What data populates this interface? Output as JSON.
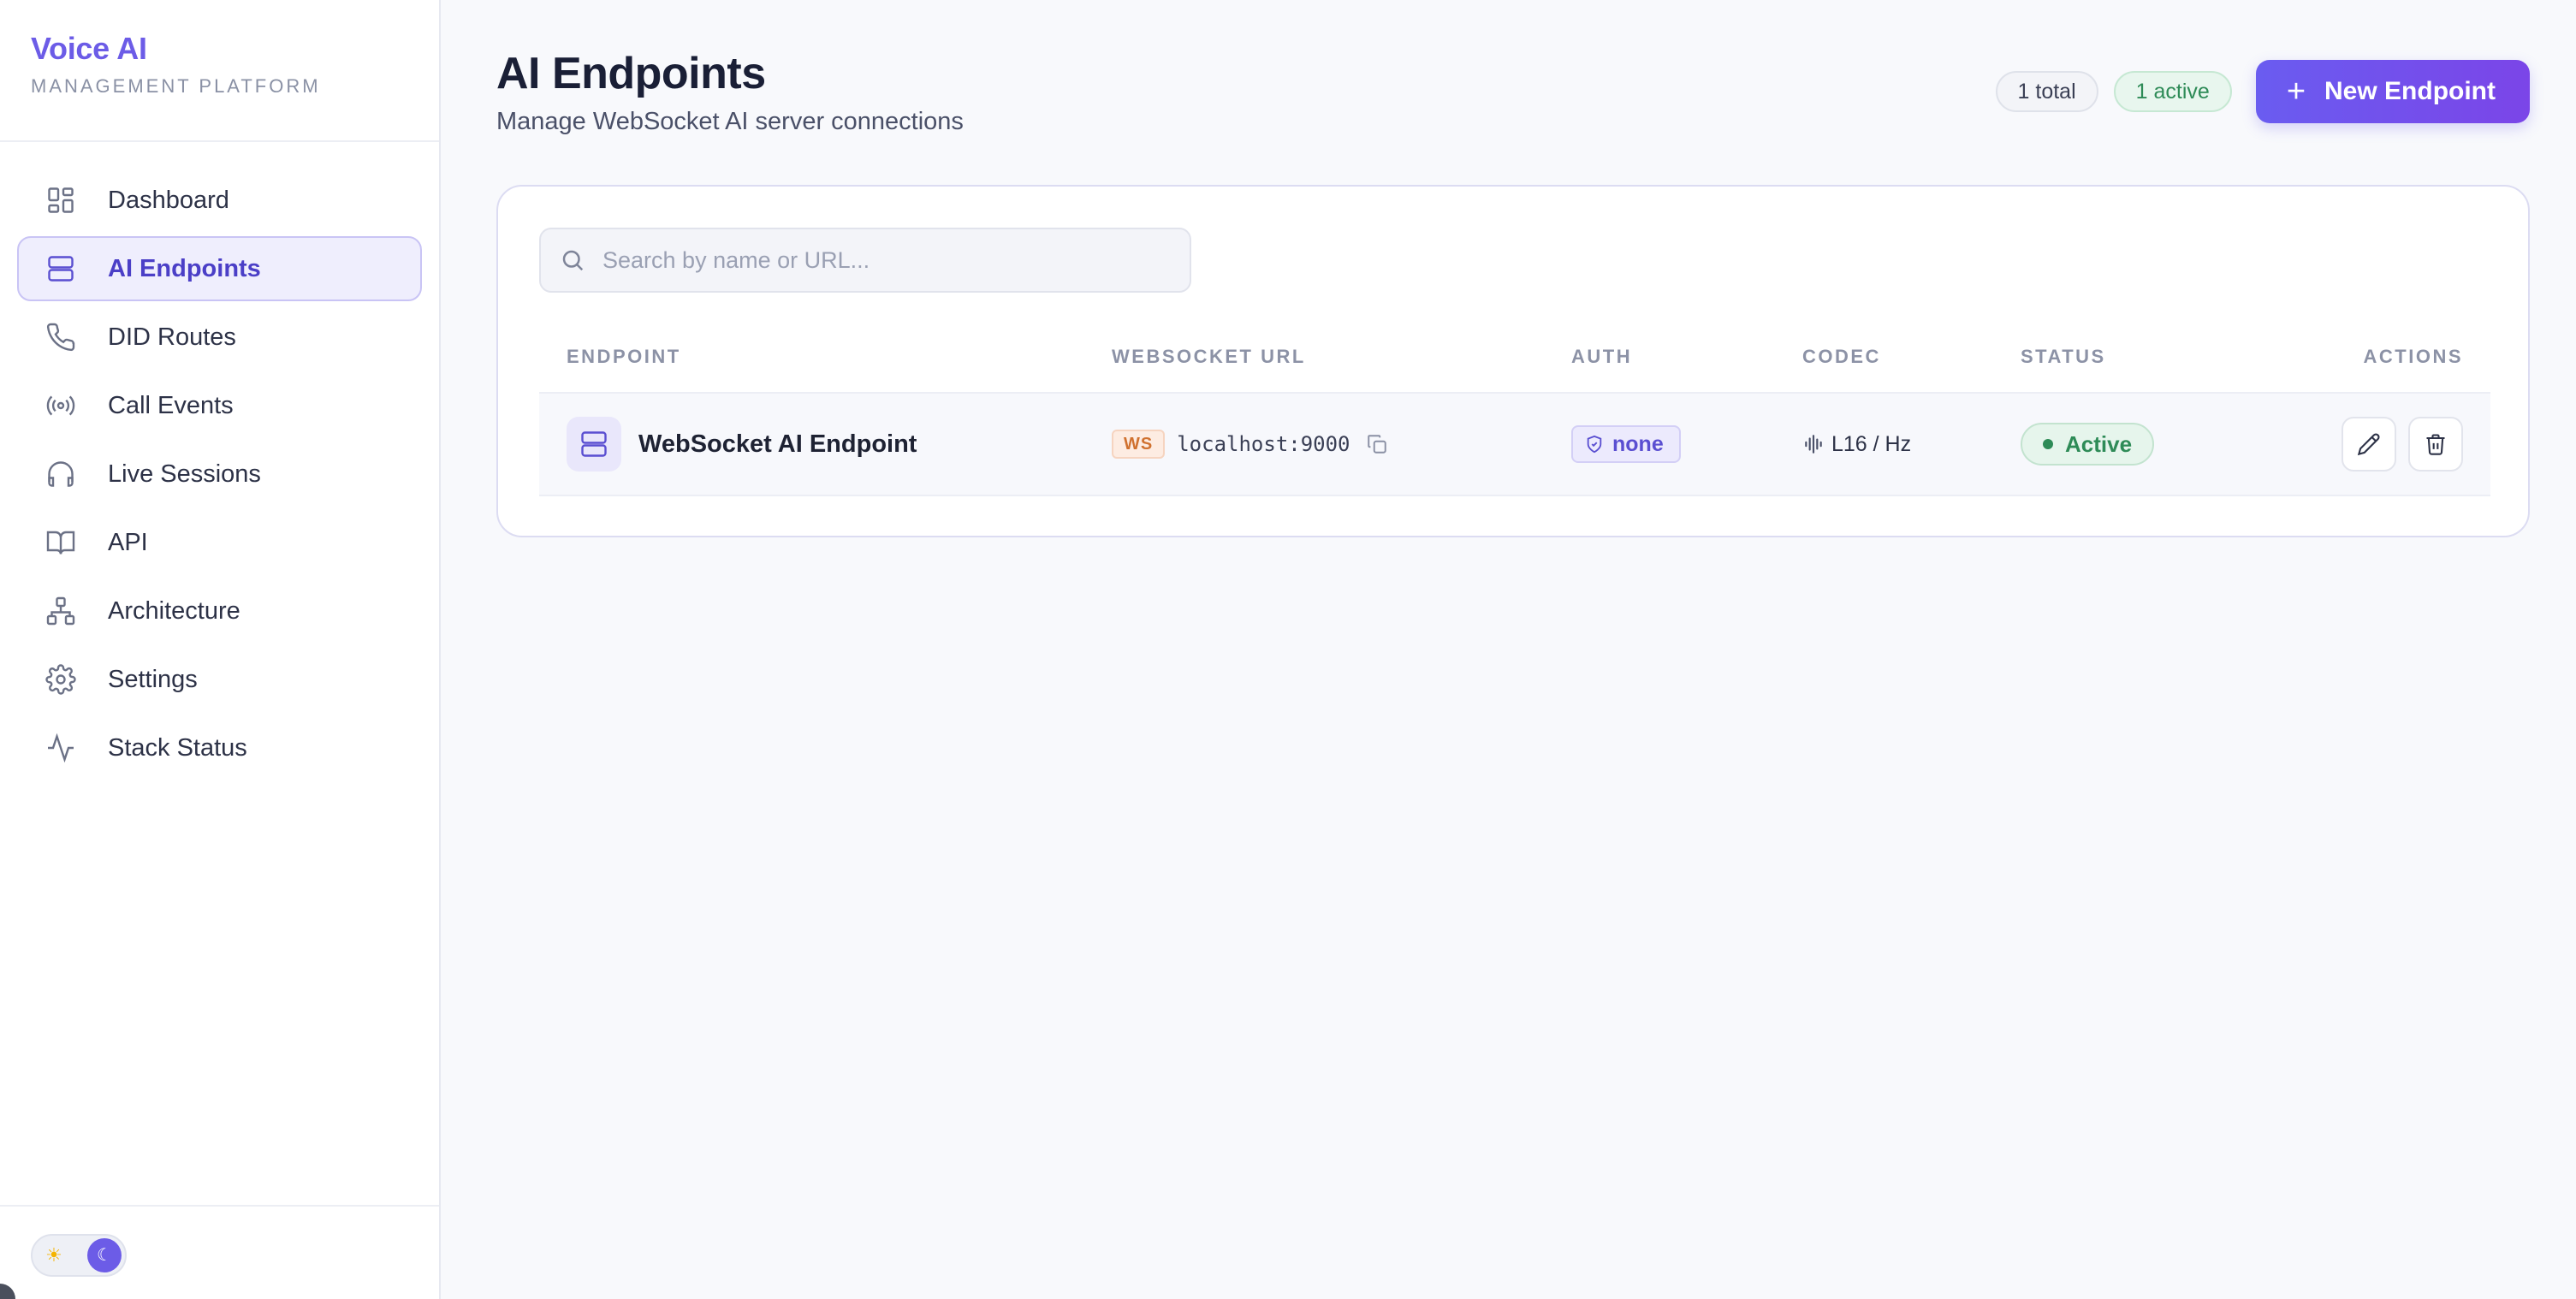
{
  "brand": {
    "title": "Voice AI",
    "subtitle": "MANAGEMENT PLATFORM"
  },
  "sidebar": {
    "items": [
      {
        "label": "Dashboard",
        "icon": "dashboard-icon",
        "active": false
      },
      {
        "label": "AI Endpoints",
        "icon": "server-icon",
        "active": true
      },
      {
        "label": "DID Routes",
        "icon": "phone-icon",
        "active": false
      },
      {
        "label": "Call Events",
        "icon": "broadcast-icon",
        "active": false
      },
      {
        "label": "Live Sessions",
        "icon": "headphones-icon",
        "active": false
      },
      {
        "label": "API",
        "icon": "book-icon",
        "active": false
      },
      {
        "label": "Architecture",
        "icon": "network-icon",
        "active": false
      },
      {
        "label": "Settings",
        "icon": "gear-icon",
        "active": false
      },
      {
        "label": "Stack Status",
        "icon": "activity-icon",
        "active": false
      }
    ],
    "theme": {
      "light_icon": "sun-icon",
      "dark_icon": "moon-icon",
      "mode": "dark"
    }
  },
  "header": {
    "title": "AI Endpoints",
    "subtitle": "Manage WebSocket AI server connections",
    "total_badge": "1 total",
    "active_badge": "1 active",
    "new_button": "New Endpoint"
  },
  "search": {
    "placeholder": "Search by name or URL...",
    "value": ""
  },
  "table": {
    "columns": [
      "ENDPOINT",
      "WEBSOCKET URL",
      "AUTH",
      "CODEC",
      "STATUS",
      "ACTIONS"
    ],
    "rows": [
      {
        "name": "WebSocket AI Endpoint",
        "protocol": "WS",
        "url": "localhost:9000",
        "auth": "none",
        "codec": "L16 / Hz",
        "status": "Active"
      }
    ]
  },
  "colors": {
    "accent": "#6c5ce7",
    "success": "#2e8b57",
    "ws_tag": "#d0712f",
    "background": "#f8f9fc"
  }
}
